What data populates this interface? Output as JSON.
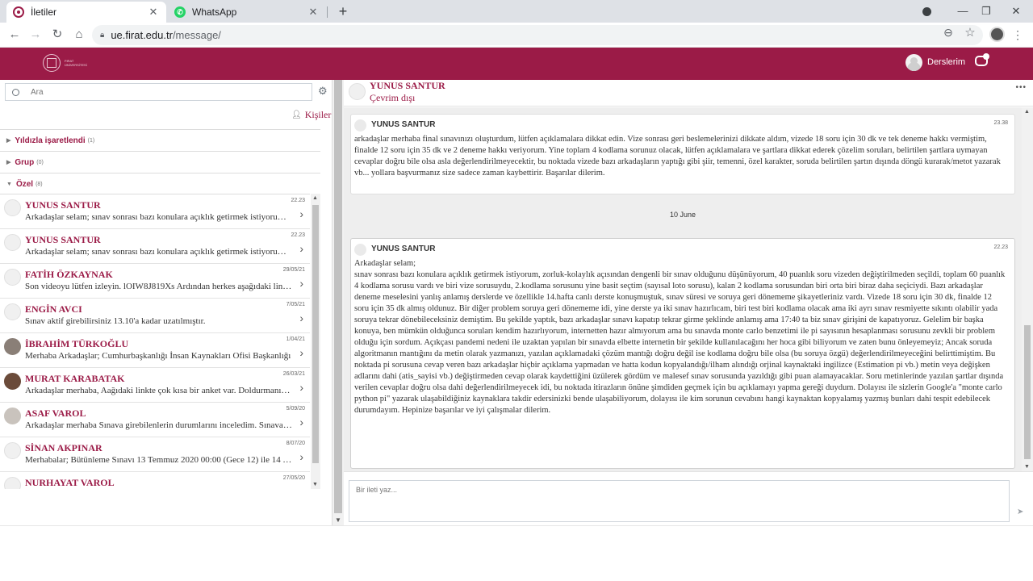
{
  "browser": {
    "tabs": [
      {
        "label": "İletiler",
        "active": true
      },
      {
        "label": "WhatsApp",
        "active": false
      }
    ],
    "close_glyph": "✕",
    "new_tab_glyph": "+",
    "url_host": "ue.firat.edu.tr",
    "url_path": "/message/",
    "window_min": "—",
    "window_max": "❐",
    "window_close": "✕"
  },
  "site": {
    "logo_text": "FIRAT ÜNİVERSİTESİ",
    "courses_label": "Derslerim",
    "brand_color": "#9b1b47"
  },
  "sidebar": {
    "search_placeholder": "Ara",
    "contacts_label": "Kişiler",
    "sections": [
      {
        "label": "Yıldızla işaretlendi",
        "count": "(1)",
        "expanded": false
      },
      {
        "label": "Grup",
        "count": "(0)",
        "expanded": false
      },
      {
        "label": "Özel",
        "count": "(8)",
        "expanded": true
      }
    ],
    "conversations": [
      {
        "name": "YUNUS SANTUR",
        "date": "22.23",
        "preview": "Arkadaşlar selam; sınav sonrası bazı konulara açıklık getirmek istiyorum, zorluk-kolaylık açısından"
      },
      {
        "name": "YUNUS SANTUR",
        "date": "22.23",
        "preview": "Arkadaşlar selam; sınav sonrası bazı konulara açıklık getirmek istiyorum, zorluk-kolaylık açısından"
      },
      {
        "name": "FATİH ÖZKAYNAK",
        "date": "29/05/21",
        "preview": "Son videoyu lütfen izleyin. lOIW8J819Xs Ardından herkes aşağıdaki linkten"
      },
      {
        "name": "ENGİN AVCI",
        "date": "7/05/21",
        "preview": "Sınav aktif girebilirsiniz 13.10'a kadar uzatılmıştır."
      },
      {
        "name": "İBRAHİM TÜRKOĞLU",
        "date": "1/04/21",
        "preview": "Merhaba Arkadaşlar; Cumhurbaşkanlığı İnsan Kaynakları Ofisi Başkanlığı"
      },
      {
        "name": "MURAT KARABATAK",
        "date": "26/03/21",
        "preview": "Arkadaşlar merhaba, Aağıdaki linkte çok kısa bir anket var. Doldurmanızı rica ederim"
      },
      {
        "name": "ASAF VAROL",
        "date": "5/09/20",
        "preview": "Arkadaşlar merhaba Sınava girebilenlerin durumlarını inceledim. Sınava giremeyenler"
      },
      {
        "name": "SİNAN AKPINAR",
        "date": "8/07/20",
        "preview": "Merhabalar; Bütünleme Sınavı 13 Temmuz 2020 00:00 (Gece 12) ile 14 Temmuz"
      },
      {
        "name": "NURHAYAT VAROL",
        "date": "27/05/20",
        "preview": ""
      }
    ]
  },
  "chat": {
    "contact_name": "YUNUS SANTUR",
    "status": "Çevrim dışı",
    "menu_glyph": "•••",
    "date_separator": "10 June",
    "messages": [
      {
        "sender": "YUNUS SANTUR",
        "time": "23.38",
        "body": "arkadaşlar merhaba final sınavınızı oluşturdum, lütfen açıklamalara dikkat edin. Vize sonrası geri beslemelerinizi dikkate aldım, vizede 18 soru için 30 dk ve tek deneme hakkı vermiştim, finalde 12 soru için 35 dk ve 2 deneme hakkı veriyorum. Yine toplam 4 kodlama sorunuz olacak, lütfen açıklamalara ve şartlara dikkat ederek çözelim soruları, belirtilen şartlara uymayan cevaplar doğru bile olsa asla değerlendirilmeyecektir, bu noktada vizede bazı arkadaşların yaptığı gibi şiir, temenni, özel karakter, soruda belirtilen şartın dışında döngü kurarak/metot yazarak vb... yollara başvurmanız size sadece zaman kaybettirir. Başarılar dilerim."
      },
      {
        "sender": "YUNUS SANTUR",
        "time": "22.23",
        "body": "Arkadaşlar selam;\nsınav sonrası bazı konulara açıklık getirmek istiyorum, zorluk-kolaylık açısından dengenli bir sınav olduğunu düşünüyorum, 40 puanlık soru vizeden değiştirilmeden seçildi, toplam 60 puanlık 4 kodlama sorusu vardı ve biri vize sorusuydu, 2.kodlama sorusunu yine basit seçtim (sayısal loto sorusu), kalan 2 kodlama sorusundan biri orta biri biraz daha seçiciydi. Bazı arkadaşlar deneme meselesini yanlış anlamış derslerde ve özellikle 14.hafta canlı derste konuşmuştuk, sınav süresi ve soruya geri dönememe şikayetleriniz vardı. Vizede 18 soru için 30 dk, finalde 12 soru için 35 dk almış oldunuz. Bir diğer problem soruya geri dönememe idi, yine derste ya iki sınav hazırlıcam, biri test biri kodlama olacak ama iki ayrı sınav resmiyette sıkıntı olabilir yada soruya tekrar dönebileceksiniz demiştim. Bu şekilde yaptık, bazı arkadaşlar sınavı kapatıp tekrar girme şeklinde anlamış ama 17:40 ta biz sınav girişini de kapatıyoruz. Gelelim bir başka konuya, ben mümkün olduğunca soruları kendim hazırlıyorum, internetten hazır almıyorum ama bu sınavda monte carlo benzetimi ile pi sayısının hesaplanması sorusunu zevkli bir problem olduğu için sordum. Açıkçası pandemi nedeni ile uzaktan yapılan bir sınavda elbette internetin bir şekilde kullanılacağını her hoca gibi biliyorum ve zaten bunu önleyemeyiz; Ancak soruda algoritmanın mantığını da metin olarak yazmanızı, yazılan açıklamadaki çözüm mantığı doğru değil ise kodlama doğru bile olsa (bu soruya özgü) değerlendirilmeyeceğini belirttimiştim. Bu noktada pi sorusuna cevap veren bazı arkadaşlar hiçbir açıklama yapmadan ve hatta kodun kopyalandığı/ilham alındığı orjinal kaynaktaki ingilizce (Estimation pi vb.) metin veya değişken adlarını dahi (atis_sayisi vb.) değiştirmeden cevap olarak kaydettiğini üzülerek gördüm ve malesef sınav sorusunda yazıldığı gibi puan alamayacaklar. Soru metinlerinde yazılan şartlar dışında verilen cevaplar doğru olsa dahi değerlendirilmeyecek idi, bu noktada itirazların önüne şimdiden geçmek için bu açıklamayı yapma gereği duydum. Dolayısı ile sizlerin Google'a \"monte carlo python pi\" yazarak ulaşabildiğiniz kaynaklara takdir edersinizki bende ulaşabiliyorum, dolayısı ile kim sorunun cevabını hangi kaynaktan kopyalamış yazmış bunları dahi tespit edebilecek durumdayım. Hepinize başarılar ve iyi çalışmalar dilerim."
      }
    ],
    "composer_placeholder": "Bir ileti yaz..."
  }
}
